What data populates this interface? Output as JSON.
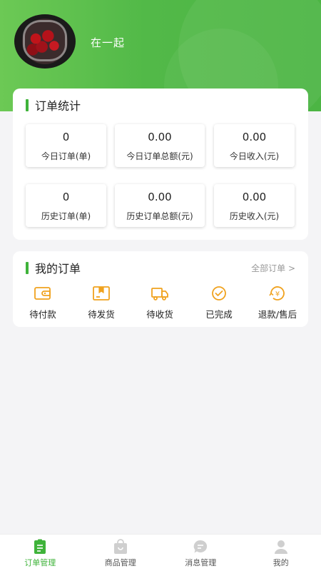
{
  "header": {
    "username": "在一起"
  },
  "stats": {
    "title": "订单统计",
    "items": [
      {
        "value": "0",
        "label": "今日订单(单)"
      },
      {
        "value": "0.00",
        "label": "今日订单总额(元)"
      },
      {
        "value": "0.00",
        "label": "今日收入(元)"
      },
      {
        "value": "0",
        "label": "历史订单(单)"
      },
      {
        "value": "0.00",
        "label": "历史订单总额(元)"
      },
      {
        "value": "0.00",
        "label": "历史收入(元)"
      }
    ]
  },
  "orders": {
    "title": "我的订单",
    "all_label": "全部订单 >",
    "items": [
      {
        "label": "待付款",
        "icon": "wallet-icon"
      },
      {
        "label": "待发货",
        "icon": "package-icon"
      },
      {
        "label": "待收货",
        "icon": "truck-icon"
      },
      {
        "label": "已完成",
        "icon": "check-circle-icon"
      },
      {
        "label": "退款/售后",
        "icon": "refund-icon"
      }
    ]
  },
  "tabbar": {
    "items": [
      {
        "label": "订单管理",
        "icon": "order-list-icon",
        "active": true
      },
      {
        "label": "商品管理",
        "icon": "shopping-bag-icon",
        "active": false
      },
      {
        "label": "消息管理",
        "icon": "message-icon",
        "active": false
      },
      {
        "label": "我的",
        "icon": "user-icon",
        "active": false
      }
    ]
  },
  "colors": {
    "accent": "#3fb33a",
    "icon_orange": "#f0a21e"
  }
}
